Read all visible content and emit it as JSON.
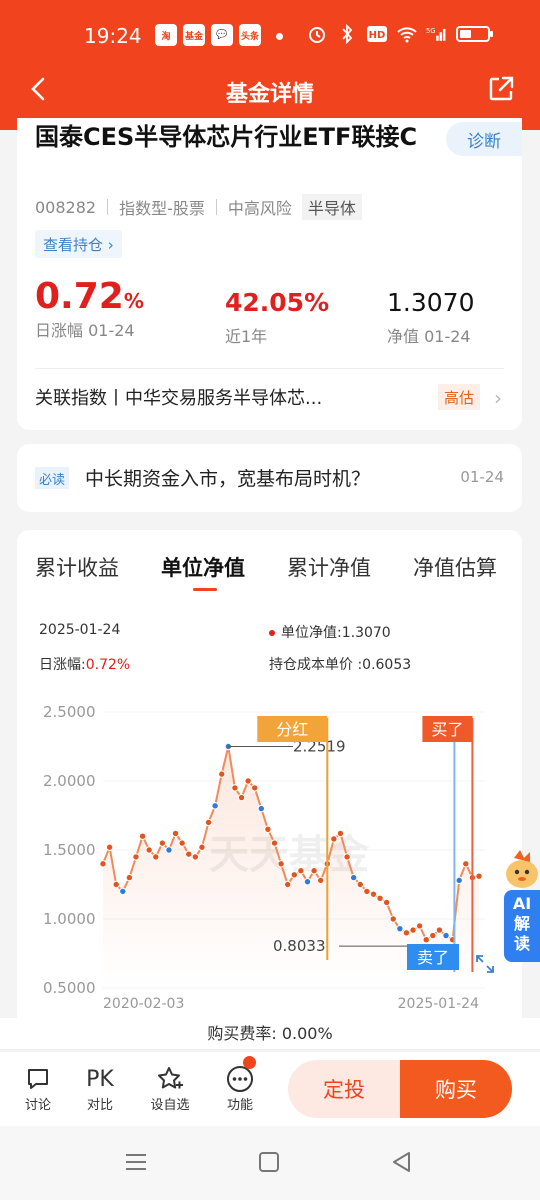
{
  "status_bar": {
    "time": "19:24",
    "app_icons": [
      "淘",
      "基金",
      "💬",
      "头条"
    ]
  },
  "nav": {
    "title": "基金详情"
  },
  "fund": {
    "name": "国泰CES半导体芯片行业ETF联接C",
    "diagnose_label": "诊断",
    "code": "008282",
    "type": "指数型-股票",
    "risk": "中高风险",
    "sector": "半导体",
    "holdings_label": "查看持仓 ›",
    "daily_change": "0.72",
    "daily_change_unit": "%",
    "daily_change_label": "日涨幅 01-24",
    "one_year_return": "42.05%",
    "one_year_label": "近1年",
    "nav_value": "1.3070",
    "nav_label": "净值 01-24",
    "related_index": "关联指数丨中华交易服务半导体芯...",
    "valuation_tag": "高估"
  },
  "news": {
    "badge": "必读",
    "headline": "中长期资金入市，宽基布局时机？",
    "date": "01-24"
  },
  "chart_tabs": [
    "累计收益",
    "单位净值",
    "累计净值",
    "净值估算"
  ],
  "chart_info": {
    "date": "2025-01-24",
    "nav_label": "单位净值:1.3070",
    "daily_label": "日涨幅:",
    "daily_value": "0.72%",
    "cost_label": "持仓成本单价 :0.6053"
  },
  "chart_data": {
    "type": "line",
    "x_start": "2020-02-03",
    "x_end": "2025-01-24",
    "yticks": [
      "2.5000",
      "2.0000",
      "1.5000",
      "1.0000",
      "0.5000"
    ],
    "ylim": [
      0.5,
      2.5
    ],
    "series": [
      {
        "values": [
          1.4,
          1.52,
          1.25,
          1.2,
          1.3,
          1.45,
          1.6,
          1.5,
          1.45,
          1.55,
          1.5,
          1.62,
          1.55,
          1.47,
          1.45,
          1.52,
          1.7,
          1.82,
          2.05,
          2.25,
          1.95,
          1.88,
          2.0,
          1.95,
          1.8,
          1.65,
          1.55,
          1.4,
          1.25,
          1.32,
          1.35,
          1.27,
          1.35,
          1.28,
          1.4,
          1.58,
          1.62,
          1.45,
          1.3,
          1.25,
          1.2,
          1.18,
          1.15,
          1.12,
          1.0,
          0.93,
          0.9,
          0.92,
          0.95,
          0.85,
          0.88,
          0.92,
          0.88,
          0.85,
          1.28,
          1.4,
          1.3,
          1.31
        ]
      }
    ],
    "annotations": {
      "max_value": "2.2519",
      "min_value": "0.8033",
      "dividend_label": "分红",
      "buy_label": "买了",
      "sell_label": "卖了"
    },
    "watermark": "天天基金"
  },
  "fee": "购买费率: 0.00%",
  "bottom_bar": {
    "discuss": "讨论",
    "compare_icon": "PK",
    "compare": "对比",
    "watchlist": "设自选",
    "functions": "功能",
    "dingtou": "定投",
    "buy": "购买"
  },
  "ai_badge": "AI\n解\n读"
}
